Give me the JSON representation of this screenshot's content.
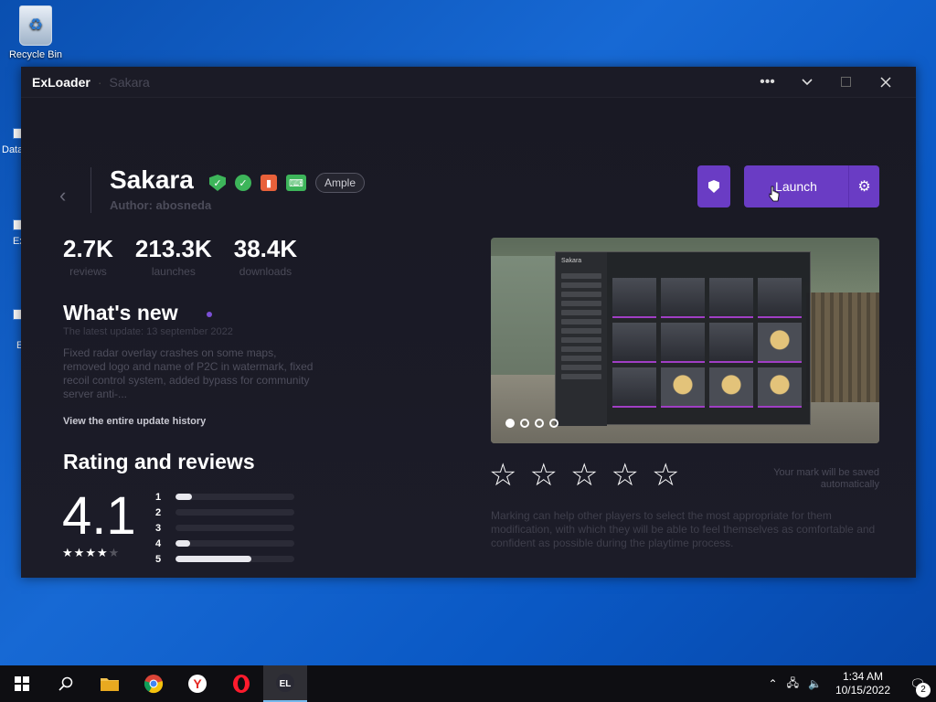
{
  "desktop": {
    "recycle_bin": "Recycle Bin",
    "peek_labels": [
      "Data",
      "Ex",
      "E"
    ]
  },
  "window": {
    "app_name": "ExLoader",
    "subtitle": "Sakara",
    "controls": [
      "more-icon",
      "chevron-down-icon",
      "maximize-icon",
      "close-icon"
    ]
  },
  "header": {
    "title": "Sakara",
    "author": "Author: abosneda",
    "tag": "Ample"
  },
  "stats": [
    {
      "value": "2.7K",
      "label": "reviews"
    },
    {
      "value": "213.3K",
      "label": "launches"
    },
    {
      "value": "38.4K",
      "label": "downloads"
    }
  ],
  "whats_new": {
    "title": "What's new",
    "date": "The latest update: 13 september 2022",
    "text": "Fixed radar overlay crashes on some maps, removed logo and name of P2C in watermark, fixed recoil control system, added bypass for community server anti-...",
    "link": "View the entire update history"
  },
  "rating": {
    "title": "Rating and reviews",
    "score": "4.1",
    "stars_filled": 4,
    "stars_total": 5,
    "bars": [
      {
        "label": "1",
        "fraction": 0.14
      },
      {
        "label": "2",
        "fraction": 0.0
      },
      {
        "label": "3",
        "fraction": 0.0
      },
      {
        "label": "4",
        "fraction": 0.12
      },
      {
        "label": "5",
        "fraction": 0.64
      }
    ]
  },
  "actions": {
    "launch_label": "Launch"
  },
  "gallery": {
    "panel_title": "Sakara",
    "slides": 4,
    "active_slide": 0
  },
  "mark": {
    "note": "Your mark will be saved automatically",
    "description": "Marking can help other players to select the most appropriate for them modification, with which they will be able to feel themselves as comfortable and confident as possible during the playtime process."
  },
  "taskbar": {
    "time": "1:34 AM",
    "date": "10/15/2022",
    "notifications": "2"
  },
  "colors": {
    "accent": "#6a3cc4",
    "window_bg": "#1b1b26",
    "badge_green": "#3db55a",
    "badge_orange": "#e8613a"
  }
}
